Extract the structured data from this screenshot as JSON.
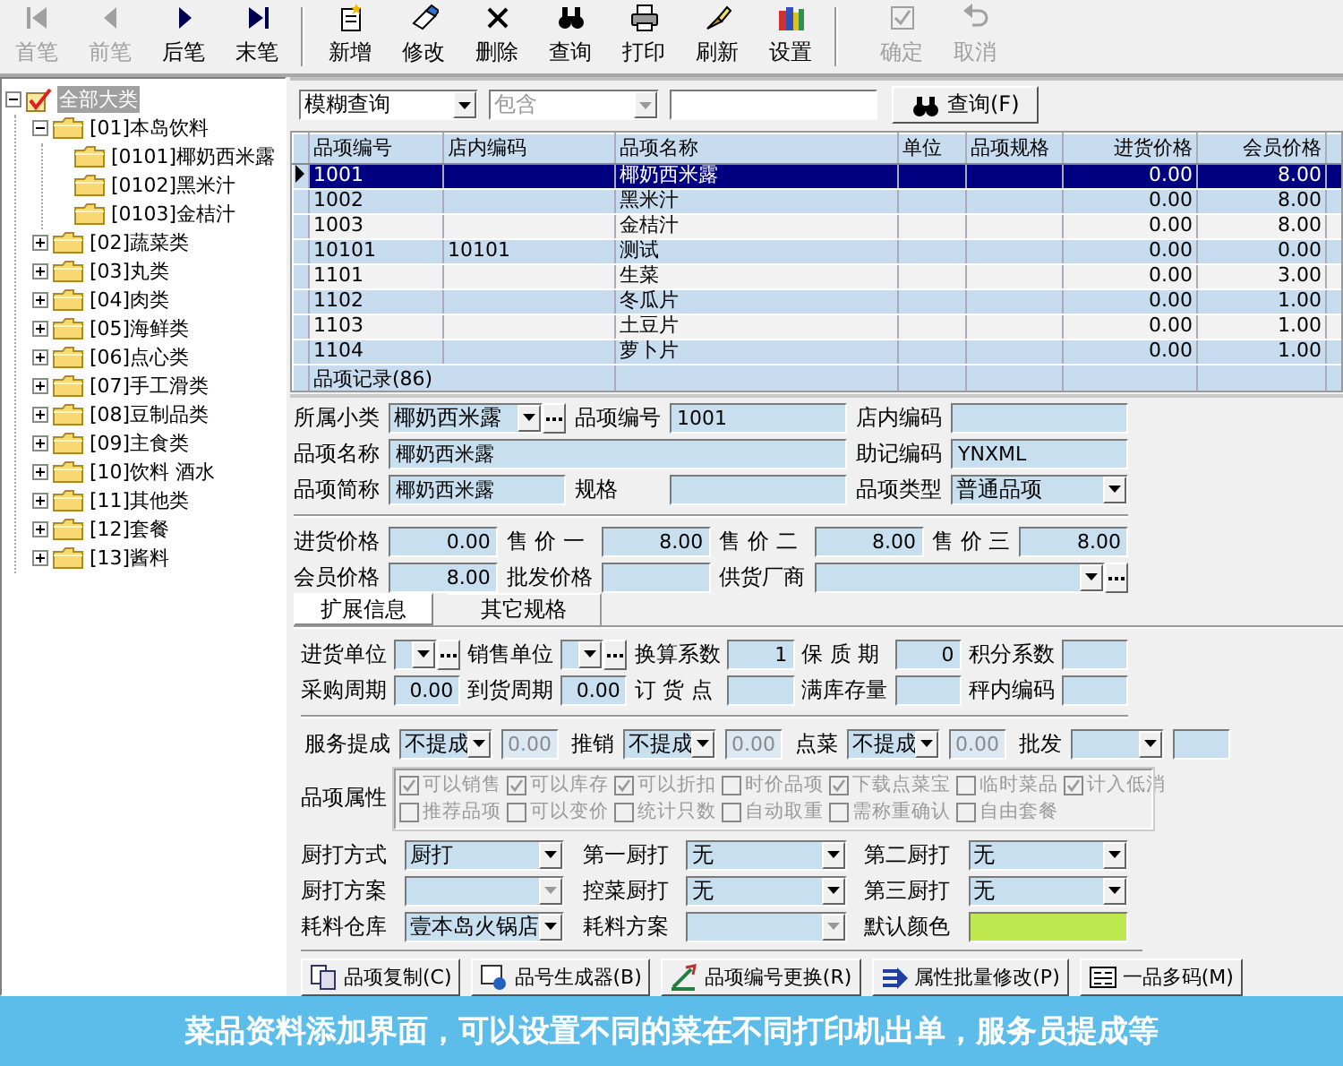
{
  "toolbar": {
    "groups": [
      [
        {
          "kind": "first",
          "label": "首笔",
          "disabled": true
        },
        {
          "kind": "prev",
          "label": "前笔",
          "disabled": true
        },
        {
          "kind": "next",
          "label": "后笔",
          "disabled": false
        },
        {
          "kind": "last",
          "label": "末笔",
          "disabled": false
        }
      ],
      [
        {
          "kind": "new",
          "label": "新增",
          "disabled": false
        },
        {
          "kind": "edit",
          "label": "修改",
          "disabled": false
        },
        {
          "kind": "delete",
          "label": "删除",
          "disabled": false
        },
        {
          "kind": "search",
          "label": "查询",
          "disabled": false
        },
        {
          "kind": "print",
          "label": "打印",
          "disabled": false
        },
        {
          "kind": "refresh",
          "label": "刷新",
          "disabled": false
        },
        {
          "kind": "settings",
          "label": "设置",
          "disabled": false
        }
      ],
      [
        {
          "kind": "confirm",
          "label": "确定",
          "disabled": true
        },
        {
          "kind": "cancel",
          "label": "取消",
          "disabled": true
        }
      ]
    ]
  },
  "tree": {
    "label": "全部大类",
    "checked": true,
    "selected": true,
    "expanded": true,
    "children": [
      {
        "label": "[01]本岛饮料",
        "selected": false,
        "expanded": true,
        "children": [
          {
            "label": "[0101]椰奶西米露",
            "selected": false
          },
          {
            "label": "[0102]黑米汁",
            "selected": false
          },
          {
            "label": "[0103]金桔汁",
            "selected": false
          }
        ]
      },
      {
        "label": "[02]蔬菜类",
        "selected": false,
        "expanded": false
      },
      {
        "label": "[03]丸类",
        "selected": false,
        "expanded": false
      },
      {
        "label": "[04]肉类",
        "selected": false,
        "expanded": false
      },
      {
        "label": "[05]海鲜类",
        "selected": false,
        "expanded": false
      },
      {
        "label": "[06]点心类",
        "selected": false,
        "expanded": false
      },
      {
        "label": "[07]手工滑类",
        "selected": false,
        "expanded": false
      },
      {
        "label": "[08]豆制品类",
        "selected": false,
        "expanded": false
      },
      {
        "label": "[09]主食类",
        "selected": false,
        "expanded": false
      },
      {
        "label": "[10]饮料 酒水",
        "selected": false,
        "expanded": false
      },
      {
        "label": "[11]其他类",
        "selected": false,
        "expanded": false
      },
      {
        "label": "[12]套餐",
        "selected": false,
        "expanded": false
      },
      {
        "label": "[13]酱料",
        "selected": false,
        "expanded": false
      }
    ]
  },
  "search": {
    "mode": "模糊查询",
    "condition": "包含",
    "condition_disabled": true,
    "button": "查询(F)"
  },
  "table": {
    "columns": [
      {
        "label": "品项编号",
        "kind": "text"
      },
      {
        "label": "店内编码",
        "kind": "text"
      },
      {
        "label": "品项名称",
        "kind": "text"
      },
      {
        "label": "单位",
        "kind": "text"
      },
      {
        "label": "品项规格",
        "kind": "text"
      },
      {
        "label": "进货价格",
        "kind": "number"
      },
      {
        "label": "会员价格",
        "kind": "number"
      }
    ],
    "rows": [
      {
        "selected": true,
        "cells": [
          "1001",
          null,
          "椰奶西米露",
          null,
          null,
          "0.00",
          "8.00"
        ]
      },
      {
        "selected": false,
        "cells": [
          "1002",
          null,
          "黑米汁",
          null,
          null,
          "0.00",
          "8.00"
        ]
      },
      {
        "selected": false,
        "cells": [
          "1003",
          null,
          "金桔汁",
          null,
          null,
          "0.00",
          "8.00"
        ]
      },
      {
        "selected": false,
        "cells": [
          "10101",
          "10101",
          "测试",
          null,
          null,
          "0.00",
          "0.00"
        ]
      },
      {
        "selected": false,
        "cells": [
          "1101",
          null,
          "生菜",
          null,
          null,
          "0.00",
          "3.00"
        ]
      },
      {
        "selected": false,
        "cells": [
          "1102",
          null,
          "冬瓜片",
          null,
          null,
          "0.00",
          "1.00"
        ]
      },
      {
        "selected": false,
        "cells": [
          "1103",
          null,
          "土豆片",
          null,
          null,
          "0.00",
          "1.00"
        ]
      },
      {
        "selected": false,
        "cells": [
          "1104",
          null,
          "萝卜片",
          null,
          null,
          "0.00",
          "1.00"
        ]
      }
    ],
    "footer": "品项记录(86)"
  },
  "form": {
    "info": {
      "rows": [
        [
          {
            "label": "所属小类",
            "kind": "combo-more",
            "value": "椰奶西米露"
          },
          {
            "label": "品项编号",
            "kind": "text",
            "value": "1001"
          },
          {
            "label": "店内编码",
            "kind": "text"
          }
        ],
        [
          {
            "label": "品项名称",
            "kind": "text",
            "value": "椰奶西米露"
          },
          null,
          {
            "label": "助记编码",
            "kind": "text",
            "value": "YNXML"
          }
        ],
        [
          {
            "label": "品项简称",
            "kind": "text",
            "value": "椰奶西米露"
          },
          {
            "label": "规格",
            "kind": "text"
          },
          {
            "label": "品项类型",
            "kind": "combo",
            "value": "普通品项"
          }
        ]
      ]
    },
    "prices": {
      "rows": [
        [
          {
            "label": "进货价格",
            "kind": "number",
            "value": "0.00"
          },
          {
            "label": "售 价 一",
            "kind": "number",
            "value": "8.00"
          },
          {
            "label": "售 价 二",
            "kind": "number",
            "value": "8.00"
          },
          {
            "label": "售 价 三",
            "kind": "number",
            "value": "8.00"
          }
        ],
        [
          {
            "label": "会员价格",
            "kind": "number",
            "value": "8.00"
          },
          {
            "label": "批发价格",
            "kind": "number"
          },
          {
            "label": "供货厂商",
            "kind": "combo-more"
          },
          null
        ]
      ]
    }
  },
  "tabs": [
    {
      "label": "扩展信息",
      "selected": true
    },
    {
      "label": "其它规格",
      "selected": false
    }
  ],
  "ext": {
    "units": {
      "rows": [
        [
          {
            "label": "进货单位",
            "kind": "combo-more"
          },
          {
            "label": "销售单位",
            "kind": "combo-more"
          },
          {
            "label": "换算系数",
            "kind": "number",
            "value": "1"
          },
          {
            "label": "保 质 期",
            "kind": "number",
            "value": "0"
          },
          {
            "label": "积分系数",
            "kind": "number"
          }
        ],
        [
          {
            "label": "采购周期",
            "kind": "number",
            "value": "0.00"
          },
          {
            "label": "到货周期",
            "kind": "number",
            "value": "0.00"
          },
          {
            "label": "订 货 点",
            "kind": "number"
          },
          {
            "label": "满库存量",
            "kind": "number"
          },
          {
            "label": "秤内编码",
            "kind": "number"
          }
        ]
      ]
    },
    "commissions": [
      {
        "label": "服务提成",
        "mode": "不提成",
        "amount": "0.00",
        "disabled": true
      },
      {
        "label": "推销",
        "mode": "不提成",
        "amount": "0.00",
        "disabled": true
      },
      {
        "label": "点菜",
        "mode": "不提成",
        "amount": "0.00",
        "disabled": true
      },
      {
        "label": "批发",
        "disabled": false
      }
    ],
    "attributes": {
      "label": "品项属性",
      "disabled": true,
      "rows": [
        [
          {
            "label": "可以销售",
            "checked": true
          },
          {
            "label": "可以库存",
            "checked": true
          },
          {
            "label": "可以折扣",
            "checked": true
          },
          {
            "label": "时价品项",
            "checked": false
          },
          {
            "label": "下载点菜宝",
            "checked": true
          },
          {
            "label": "临时菜品",
            "checked": false
          },
          {
            "label": "计入低消",
            "checked": true
          }
        ],
        [
          {
            "label": "推荐品项",
            "checked": false
          },
          {
            "label": "可以变价",
            "checked": false
          },
          {
            "label": "统计只数",
            "checked": false
          },
          {
            "label": "自动取重",
            "checked": false
          },
          {
            "label": "需称重确认",
            "checked": false
          },
          {
            "label": "自由套餐",
            "checked": false
          }
        ]
      ]
    },
    "kitchen": {
      "rows": [
        [
          {
            "label": "厨打方式",
            "kind": "combo",
            "value": "厨打"
          },
          {
            "label": "第一厨打",
            "kind": "combo",
            "value": "无"
          },
          {
            "label": "第二厨打",
            "kind": "combo",
            "value": "无"
          }
        ],
        [
          {
            "label": "厨打方案",
            "kind": "combo",
            "disabled": true
          },
          {
            "label": "控菜厨打",
            "kind": "combo",
            "value": "无"
          },
          {
            "label": "第三厨打",
            "kind": "combo",
            "value": "无"
          }
        ],
        [
          {
            "label": "耗料仓库",
            "kind": "combo",
            "value": "壹本岛火锅店"
          },
          {
            "label": "耗料方案",
            "kind": "combo",
            "disabled": true
          },
          {
            "label": "默认颜色",
            "kind": "color",
            "color": "#bde84e"
          }
        ]
      ]
    }
  },
  "actions": [
    {
      "kind": "copy",
      "label": "品项复制(C)"
    },
    {
      "kind": "generator",
      "label": "品号生成器(B)"
    },
    {
      "kind": "renumber",
      "label": "品项编号更换(R)"
    },
    {
      "kind": "batch",
      "label": "属性批量修改(P)"
    },
    {
      "kind": "multi",
      "label": "一品多码(M)"
    }
  ],
  "banner": {
    "text": "菜品资料添加界面，可以设置不同的菜在不同打印机出单，服务员提成等"
  }
}
